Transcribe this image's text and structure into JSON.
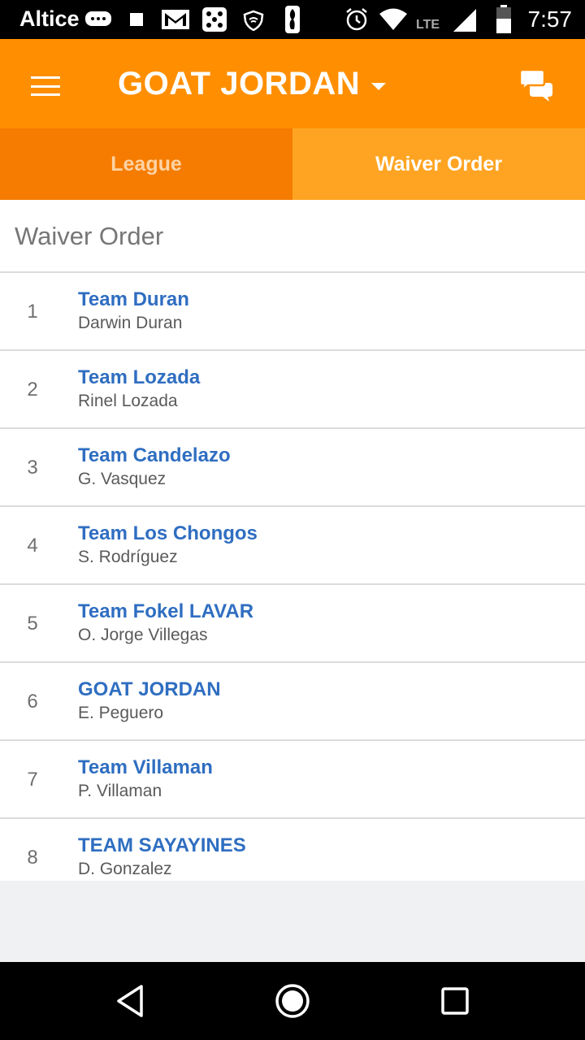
{
  "status_bar": {
    "carrier": "Altice",
    "network": "LTE",
    "time": "7:57"
  },
  "app_bar": {
    "title": "GOAT JORDAN",
    "menu_icon": "menu-icon",
    "chat_icon": "chat-icon",
    "accent_color": "#ff8f00"
  },
  "tabs": [
    {
      "label": "League",
      "selected": false
    },
    {
      "label": "Waiver Order",
      "selected": true
    }
  ],
  "section_title": "Waiver Order",
  "waiver_list": [
    {
      "rank": "1",
      "team": "Team Duran",
      "owner": "Darwin Duran"
    },
    {
      "rank": "2",
      "team": "Team Lozada",
      "owner": "Rinel Lozada"
    },
    {
      "rank": "3",
      "team": "Team Candelazo",
      "owner": "G. Vasquez"
    },
    {
      "rank": "4",
      "team": "Team Los Chongos",
      "owner": "S. Rodríguez"
    },
    {
      "rank": "5",
      "team": "Team Fokel LAVAR",
      "owner": "O. Jorge Villegas"
    },
    {
      "rank": "6",
      "team": "GOAT JORDAN",
      "owner": "E. Peguero"
    },
    {
      "rank": "7",
      "team": "Team Villaman",
      "owner": "P. Villaman"
    },
    {
      "rank": "8",
      "team": "TEAM SAYAYINES",
      "owner": "D. Gonzalez"
    }
  ],
  "link_color": "#2f6ec1"
}
